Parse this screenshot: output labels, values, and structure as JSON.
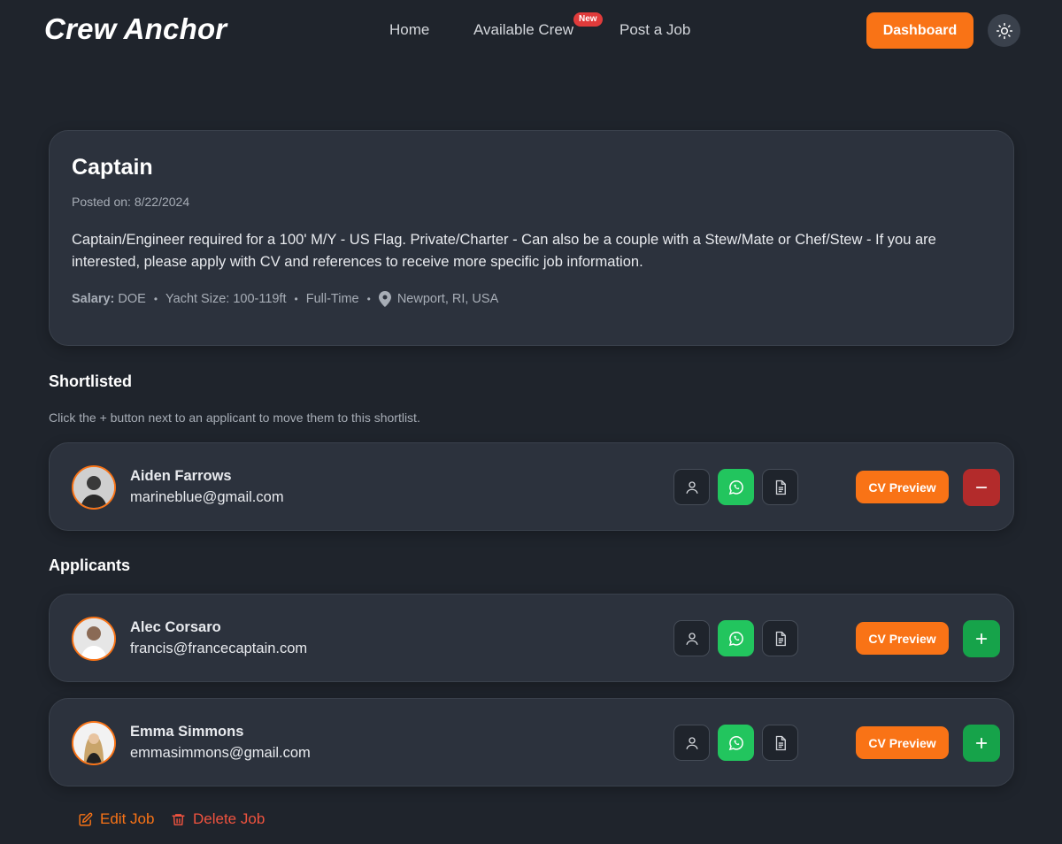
{
  "header": {
    "logo": "Crew Anchor",
    "nav": [
      {
        "label": "Home"
      },
      {
        "label": "Available Crew",
        "badge": "New"
      },
      {
        "label": "Post a Job"
      }
    ],
    "dashboard_label": "Dashboard",
    "theme_icon": "sun-icon"
  },
  "job": {
    "title": "Captain",
    "posted": "Posted on: 8/22/2024",
    "description": "Captain/Engineer required for a 100' M/Y - US Flag. Private/Charter - Can also be a couple with a Stew/Mate or Chef/Stew - If you are interested, please apply with CV and references to receive more specific job information.",
    "salary_label": "Salary:",
    "salary_value": "DOE",
    "yacht_size": "Yacht Size: 100-119ft",
    "employment": "Full-Time",
    "location": "Newport, RI, USA"
  },
  "shortlisted": {
    "title": "Shortlisted",
    "hint": "Click the + button next to an applicant to move them to this shortlist.",
    "items": [
      {
        "name": "Aiden Farrows",
        "email": "marineblue@gmail.com",
        "cv_label": "CV Preview"
      }
    ]
  },
  "applicants": {
    "title": "Applicants",
    "items": [
      {
        "name": "Alec Corsaro",
        "email": "francis@francecaptain.com",
        "cv_label": "CV Preview"
      },
      {
        "name": "Emma Simmons",
        "email": "emmasimmons@gmail.com",
        "cv_label": "CV Preview"
      }
    ]
  },
  "footer": {
    "edit_label": "Edit Job",
    "delete_label": "Delete Job"
  },
  "colors": {
    "background": "#1f242c",
    "card": "#2c323d",
    "accent": "#f97316",
    "whatsapp": "#22c55e",
    "add": "#16a34a",
    "remove": "#b32b2b",
    "delete": "#f0533f"
  }
}
